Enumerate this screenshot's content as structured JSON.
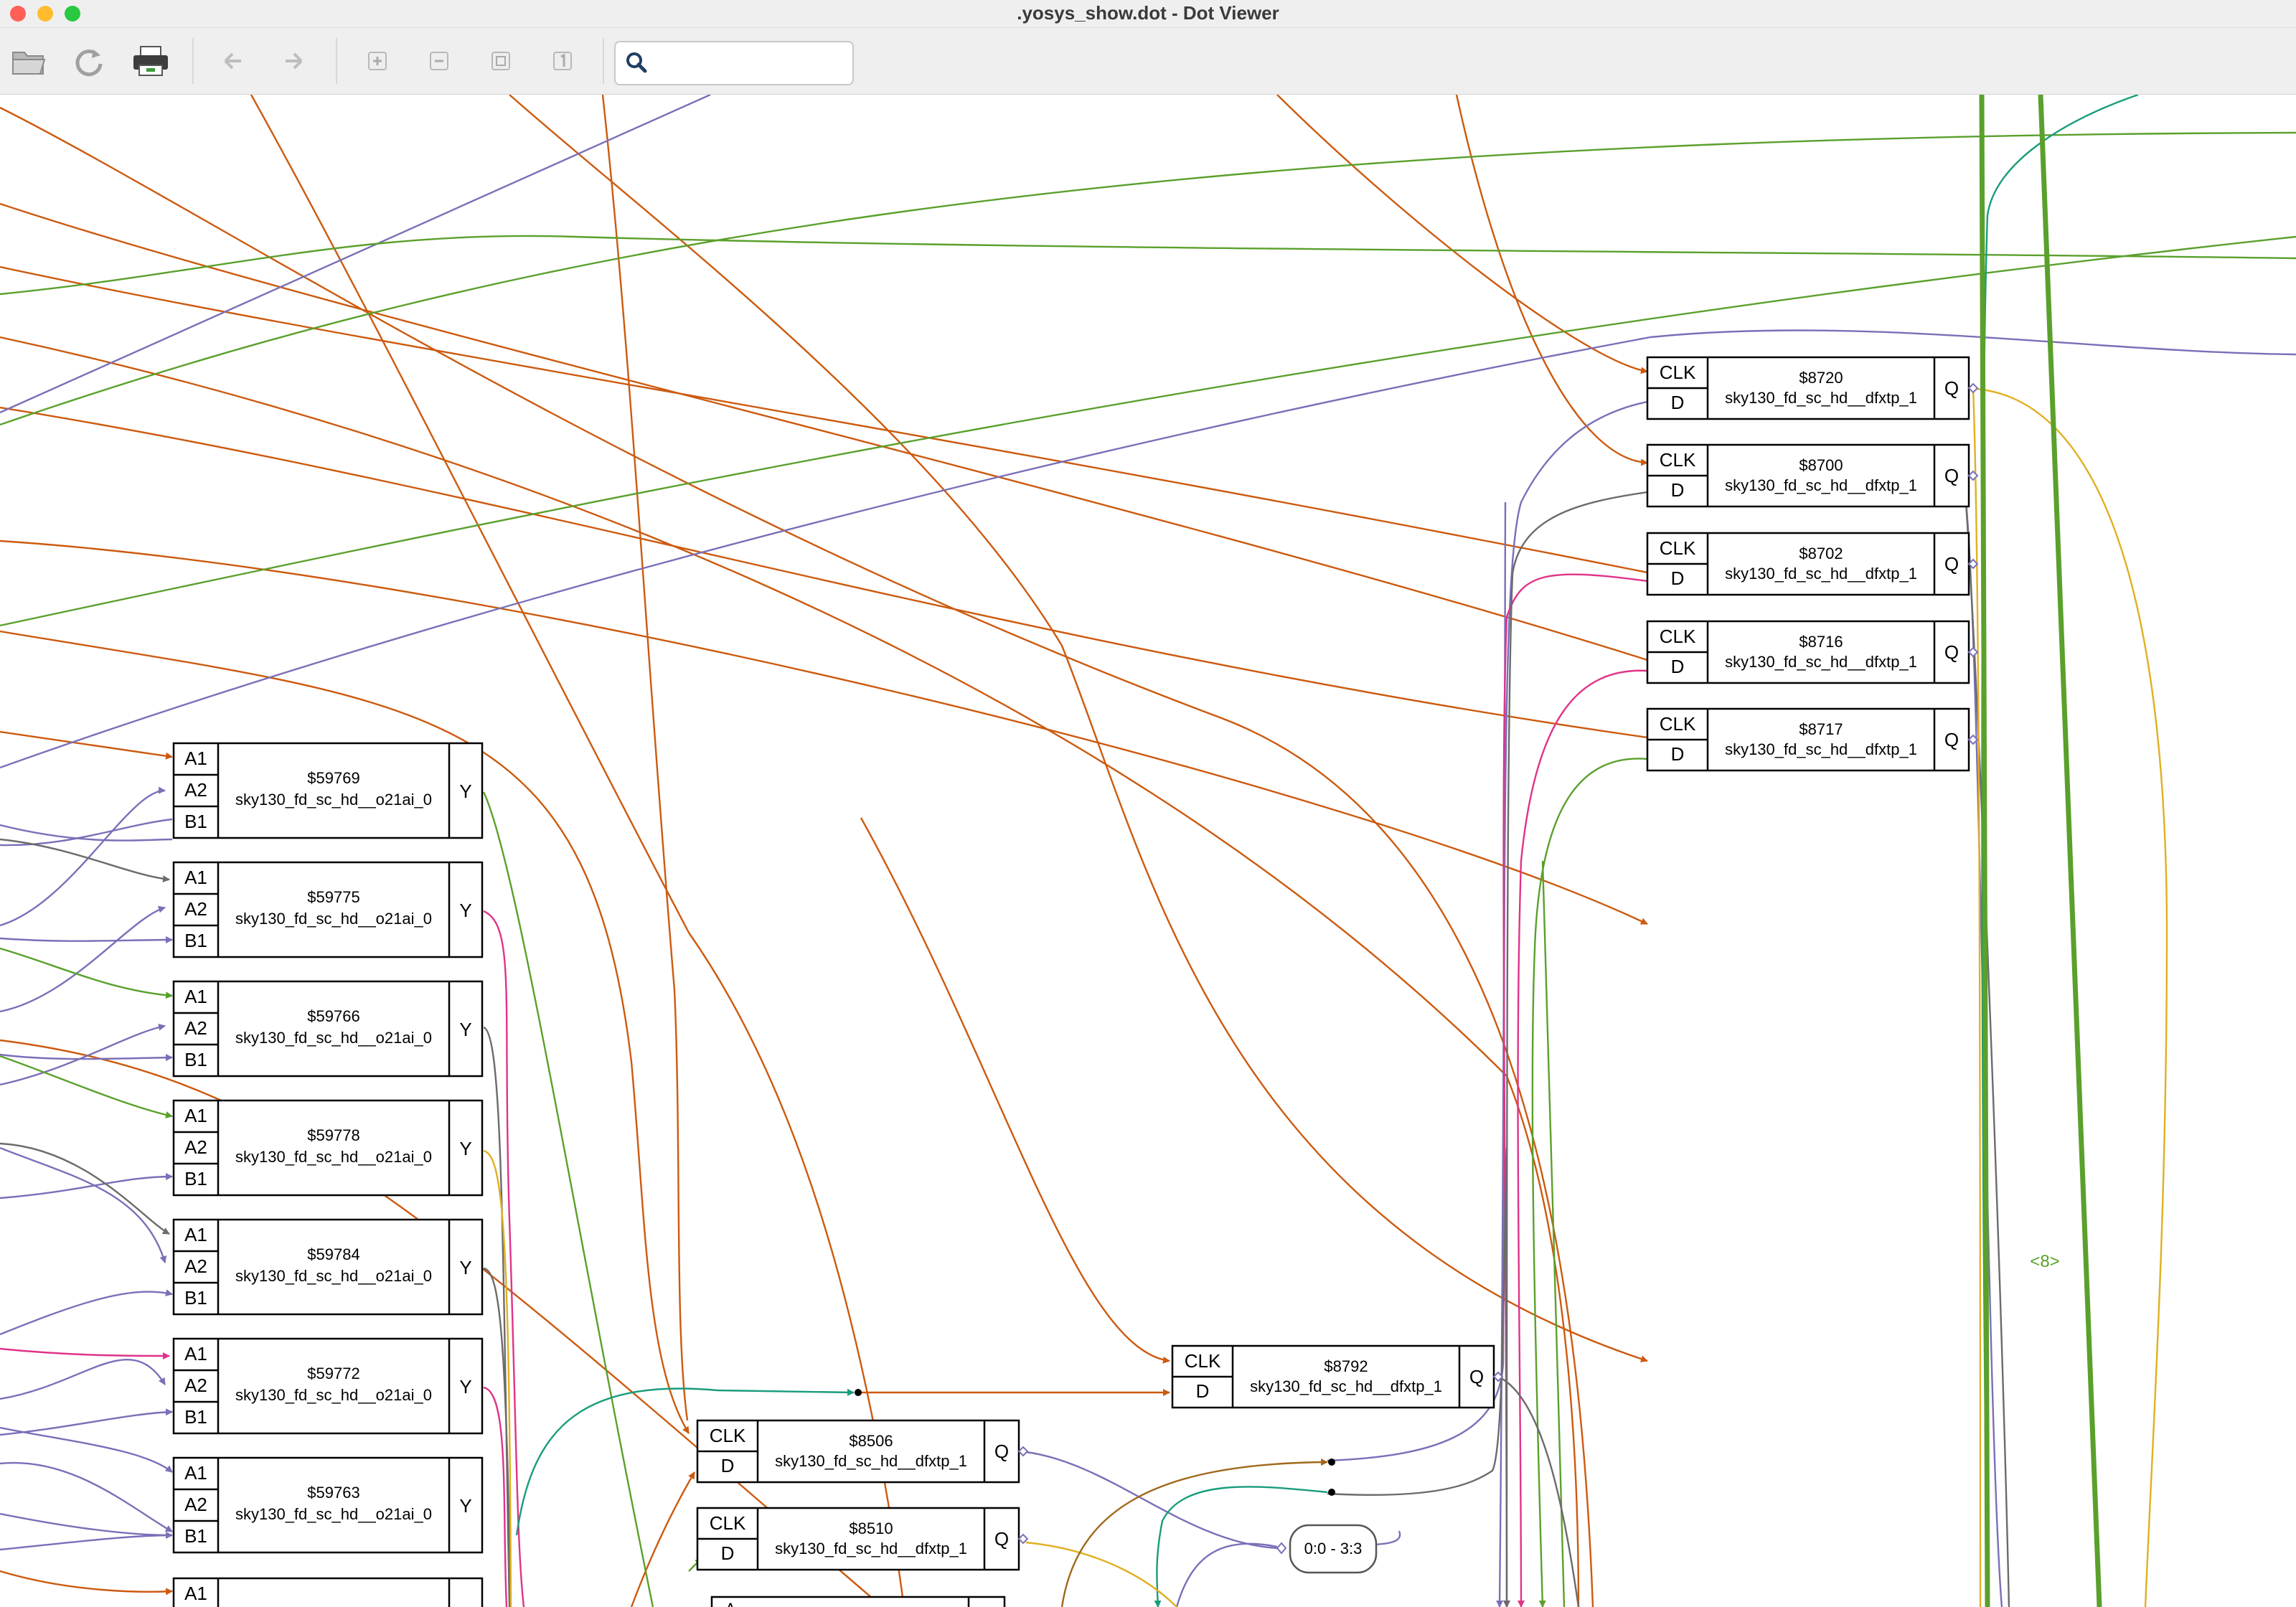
{
  "window": {
    "title": ".yosys_show.dot - Dot Viewer",
    "traffic_lights": [
      "#ff5f57",
      "#febc2e",
      "#28c840"
    ]
  },
  "toolbar": {
    "buttons": [
      {
        "name": "open-button",
        "icon": "folder-open-icon"
      },
      {
        "name": "reload-button",
        "icon": "reload-icon"
      },
      {
        "name": "print-button",
        "icon": "printer-icon"
      },
      {
        "name": "back-button",
        "icon": "back-arrow-icon"
      },
      {
        "name": "forward-button",
        "icon": "forward-arrow-icon"
      },
      {
        "name": "zoom-in-button",
        "icon": "zoom-in-icon"
      },
      {
        "name": "zoom-out-button",
        "icon": "zoom-out-icon"
      },
      {
        "name": "zoom-fit-button",
        "icon": "zoom-fit-icon"
      },
      {
        "name": "zoom-100-button",
        "icon": "zoom-100-icon"
      }
    ],
    "search": {
      "placeholder": "",
      "value": ""
    }
  },
  "graph": {
    "edge_colors": {
      "orange": "#cc5a0f",
      "purple": "#7a6fb8",
      "green": "#5aa02c",
      "pink": "#e0338a",
      "gray": "#6b6b6b",
      "teal": "#1a9c7c",
      "gold": "#e0b020",
      "brown": "#a0681a"
    },
    "o21ai_cells": [
      {
        "id": "$59769",
        "type": "sky130_fd_sc_hd__o21ai_0",
        "inputs": [
          "A1",
          "A2",
          "B1"
        ],
        "output": "Y"
      },
      {
        "id": "$59775",
        "type": "sky130_fd_sc_hd__o21ai_0",
        "inputs": [
          "A1",
          "A2",
          "B1"
        ],
        "output": "Y"
      },
      {
        "id": "$59766",
        "type": "sky130_fd_sc_hd__o21ai_0",
        "inputs": [
          "A1",
          "A2",
          "B1"
        ],
        "output": "Y"
      },
      {
        "id": "$59778",
        "type": "sky130_fd_sc_hd__o21ai_0",
        "inputs": [
          "A1",
          "A2",
          "B1"
        ],
        "output": "Y"
      },
      {
        "id": "$59784",
        "type": "sky130_fd_sc_hd__o21ai_0",
        "inputs": [
          "A1",
          "A2",
          "B1"
        ],
        "output": "Y"
      },
      {
        "id": "$59772",
        "type": "sky130_fd_sc_hd__o21ai_0",
        "inputs": [
          "A1",
          "A2",
          "B1"
        ],
        "output": "Y"
      },
      {
        "id": "$59763",
        "type": "sky130_fd_sc_hd__o21ai_0",
        "inputs": [
          "A1",
          "A2",
          "B1"
        ],
        "output": "Y"
      }
    ],
    "partial_cell_port": "A1",
    "partial_cell_port_2": "A",
    "dff_right": [
      {
        "id": "$8720",
        "type": "sky130_fd_sc_hd__dfxtp_1",
        "inputs": [
          "CLK",
          "D"
        ],
        "output": "Q"
      },
      {
        "id": "$8700",
        "type": "sky130_fd_sc_hd__dfxtp_1",
        "inputs": [
          "CLK",
          "D"
        ],
        "output": "Q"
      },
      {
        "id": "$8702",
        "type": "sky130_fd_sc_hd__dfxtp_1",
        "inputs": [
          "CLK",
          "D"
        ],
        "output": "Q"
      },
      {
        "id": "$8716",
        "type": "sky130_fd_sc_hd__dfxtp_1",
        "inputs": [
          "CLK",
          "D"
        ],
        "output": "Q"
      },
      {
        "id": "$8717",
        "type": "sky130_fd_sc_hd__dfxtp_1",
        "inputs": [
          "CLK",
          "D"
        ],
        "output": "Q"
      }
    ],
    "dff_middle": [
      {
        "id": "$8792",
        "type": "sky130_fd_sc_hd__dfxtp_1",
        "inputs": [
          "CLK",
          "D"
        ],
        "output": "Q"
      },
      {
        "id": "$8506",
        "type": "sky130_fd_sc_hd__dfxtp_1",
        "inputs": [
          "CLK",
          "D"
        ],
        "output": "Q"
      },
      {
        "id": "$8510",
        "type": "sky130_fd_sc_hd__dfxtp_1",
        "inputs": [
          "CLK",
          "D"
        ],
        "output": "Q"
      }
    ],
    "bus_label": "0:0 - 3:3",
    "width_label": "<8>"
  }
}
